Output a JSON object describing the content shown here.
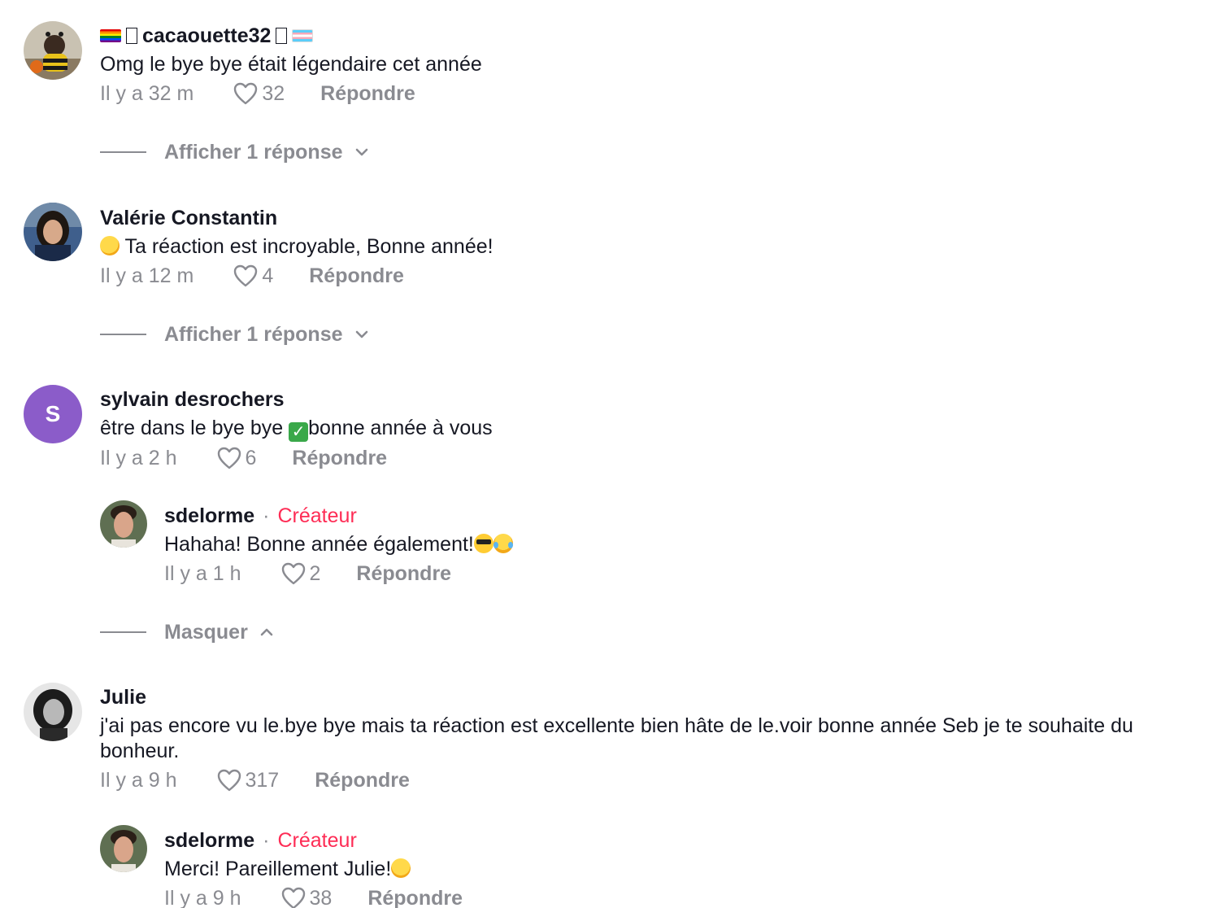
{
  "comments": [
    {
      "username": "cacaouette32",
      "text": "Omg le bye bye était légendaire cet année",
      "time": "Il y a 32 m",
      "likes": "32",
      "reply": "Répondre",
      "toggle": "Afficher 1 réponse"
    },
    {
      "username": "Valérie Constantin",
      "text": "Ta réaction est incroyable, Bonne année!",
      "time": "Il y a 12 m",
      "likes": "4",
      "reply": "Répondre",
      "toggle": "Afficher 1 réponse"
    },
    {
      "username": "sylvain desrochers",
      "avatar_letter": "S",
      "text_before": "être dans le bye bye ",
      "text_after": "bonne année à vous",
      "time": "Il y a 2 h",
      "likes": "6",
      "reply": "Répondre",
      "reply_item": {
        "username": "sdelorme",
        "dot": "·",
        "creator": "Créateur",
        "text": "Hahaha! Bonne année également!",
        "time": "Il y a 1 h",
        "likes": "2",
        "reply": "Répondre"
      },
      "toggle": "Masquer"
    },
    {
      "username": "Julie",
      "text": "j'ai pas encore vu le.bye bye mais ta réaction est excellente bien hâte de le.voir bonne année Seb je te souhaite du bonheur.",
      "time": "Il y a 9 h",
      "likes": "317",
      "reply": "Répondre",
      "reply_item": {
        "username": "sdelorme",
        "dot": "·",
        "creator": "Créateur",
        "text": "Merci! Pareillement Julie!",
        "time": "Il y a 9 h",
        "likes": "38",
        "reply": "Répondre"
      }
    }
  ],
  "colors": {
    "accent": "#fe2c55",
    "muted": "#8a8b91",
    "text": "#161823",
    "letter_avatar": "#8b5cc9"
  },
  "icons": [
    "heart-icon",
    "chevron-down-icon",
    "chevron-up-icon"
  ]
}
